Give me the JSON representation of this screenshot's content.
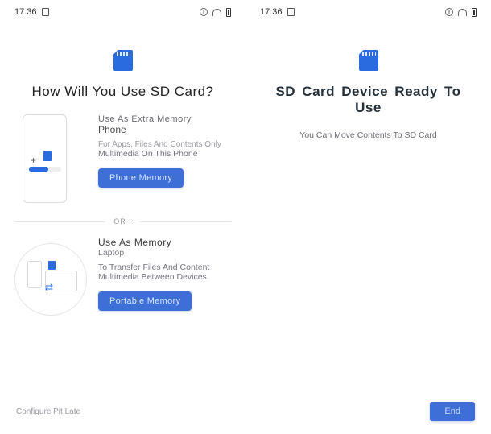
{
  "statusbar": {
    "time": "17:36"
  },
  "left": {
    "heading": "How Will You Use SD Card?",
    "option1": {
      "title": "Use As Extra Memory",
      "subtitle": "Phone",
      "note1": "For Apps, Files And Contents Only",
      "note2": "Multimedia On This Phone",
      "button": "Phone Memory"
    },
    "divider": "OR :",
    "option2": {
      "title": "Use As Memory",
      "subtitle": "Laptop",
      "note1": "To Transfer Files And Content",
      "note2": "Multimedia Between Devices",
      "button": "Portable Memory"
    },
    "footer": "Configure Pit Late"
  },
  "right": {
    "heading": "SD Card Device Ready To Use",
    "message": "You Can Move Contents To SD Card",
    "button": "End"
  }
}
